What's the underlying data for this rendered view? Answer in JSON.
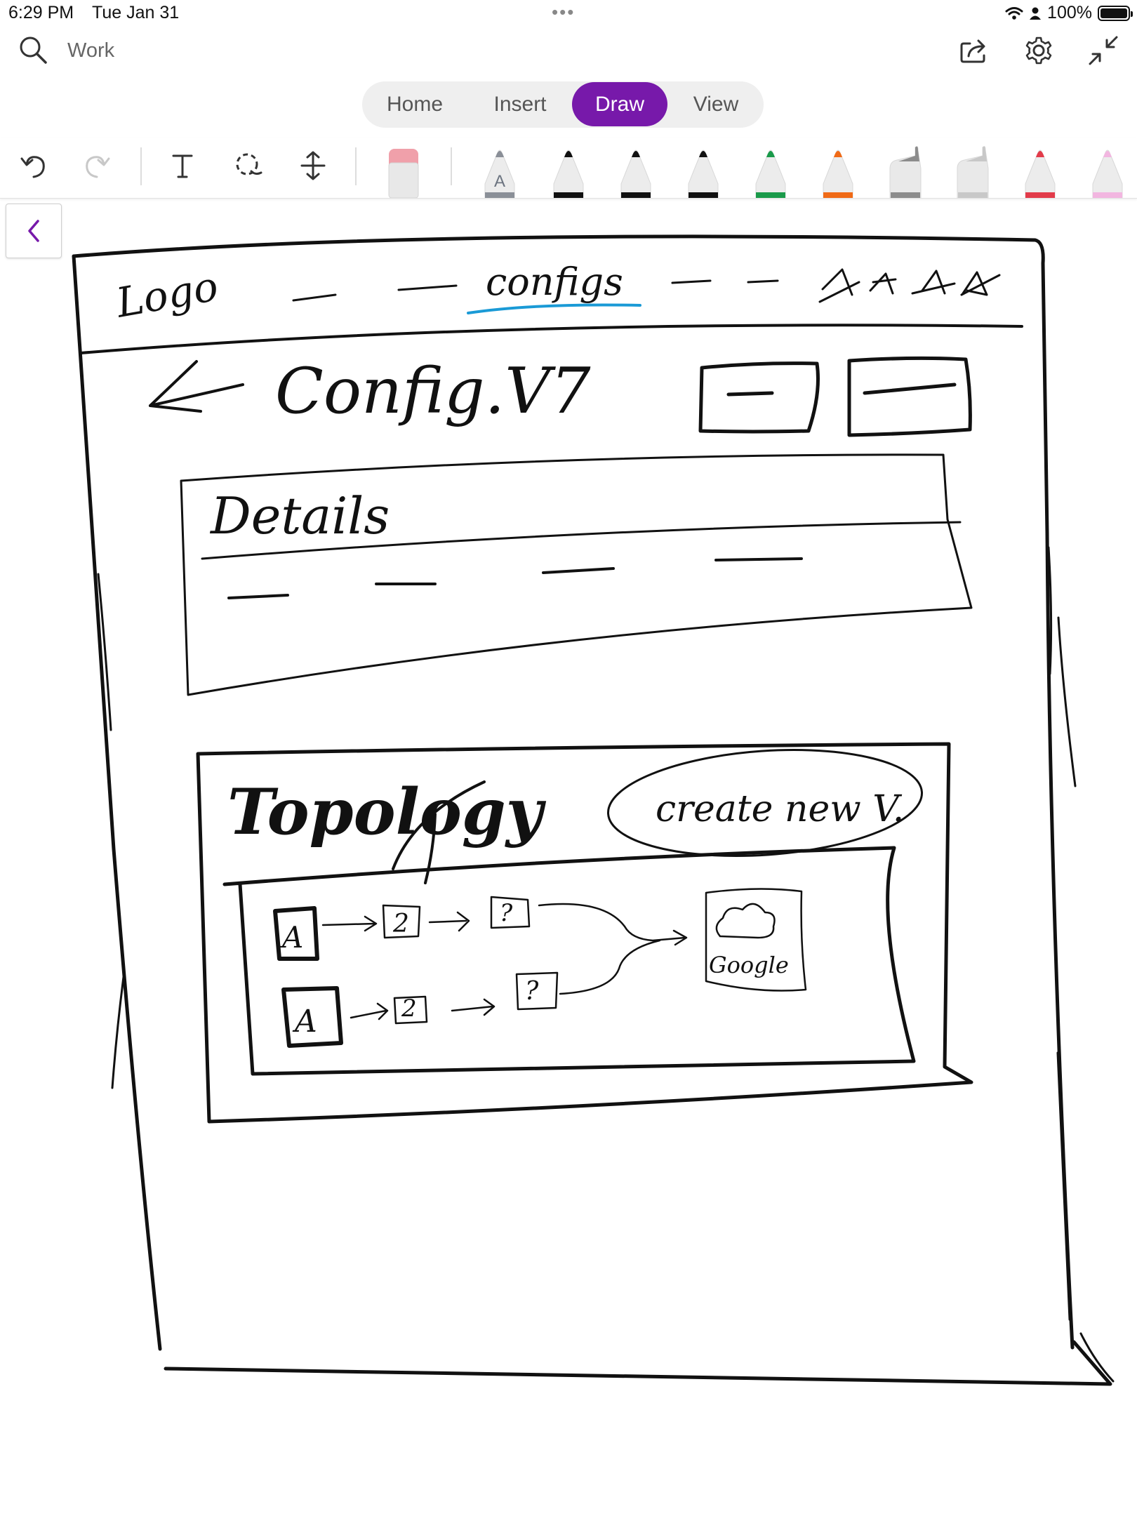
{
  "status_bar": {
    "time": "6:29 PM",
    "date": "Tue Jan 31",
    "battery": "100%"
  },
  "header": {
    "notebook_title": "Work"
  },
  "tabs": [
    {
      "label": "Home",
      "active": false
    },
    {
      "label": "Insert",
      "active": false
    },
    {
      "label": "Draw",
      "active": true
    },
    {
      "label": "View",
      "active": false
    }
  ],
  "colors": {
    "accent": "#7719aa",
    "highlight_ink": "#1a9ad6"
  },
  "toolbar": {
    "tools": [
      "undo-icon",
      "redo-icon",
      "text-icon",
      "lasso-icon",
      "add-space-icon",
      "eraser-icon"
    ],
    "pens": [
      {
        "name": "text-to-ink-pen",
        "color": "#8a8f97",
        "label": "A"
      },
      {
        "name": "pen-black-fine",
        "color": "#111111"
      },
      {
        "name": "pen-black-medium",
        "color": "#111111"
      },
      {
        "name": "pen-black-thick",
        "color": "#111111"
      },
      {
        "name": "pen-green",
        "color": "#1a9a4a"
      },
      {
        "name": "pen-orange",
        "color": "#f06a16"
      },
      {
        "name": "highlighter-gray",
        "color": "#8c8c8c"
      },
      {
        "name": "highlighter-light-gray",
        "color": "#c8c8c8"
      },
      {
        "name": "pen-red",
        "color": "#e23b4a"
      },
      {
        "name": "pen-pink",
        "color": "#f2b6e0"
      }
    ]
  },
  "sketch": {
    "nav_logo": "Logo",
    "nav_active": "configs",
    "page_heading": "Config.V7",
    "details_heading": "Details",
    "topology_heading": "Topology",
    "create_button": "create new V.",
    "node_a": "A",
    "node_two": "2",
    "node_unknown": "?",
    "cloud_label": "Google"
  }
}
